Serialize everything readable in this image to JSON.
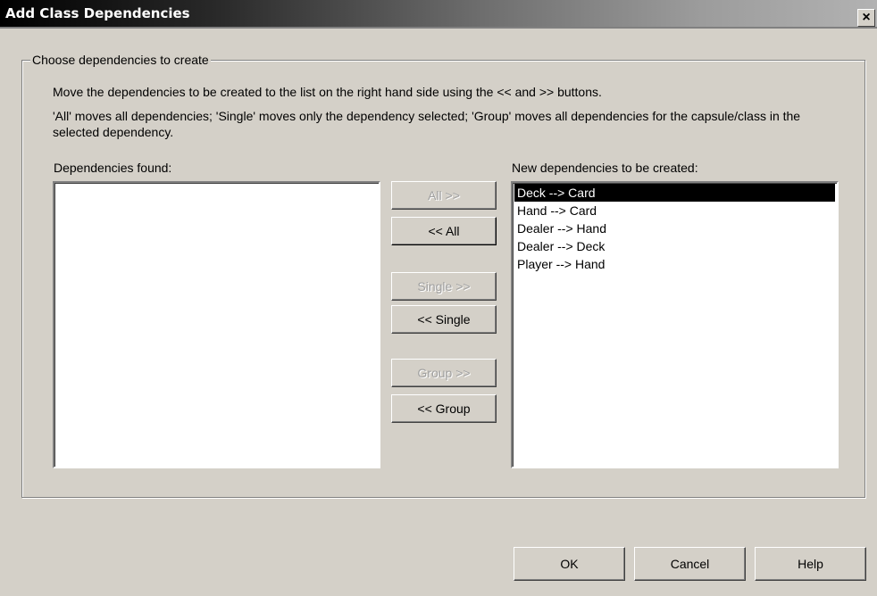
{
  "window": {
    "title": "Add Class Dependencies",
    "close_glyph": "×"
  },
  "group": {
    "legend": "Choose dependencies to create",
    "instruction1": "Move the dependencies to be created to the list on the right hand side using the << and >> buttons.",
    "instruction2": "'All' moves all dependencies; 'Single' moves only the dependency selected; 'Group' moves all dependencies for the capsule/class in the selected dependency."
  },
  "lists": {
    "found_label": "Dependencies found:",
    "new_label": "New dependencies to be created:",
    "found_items": [],
    "new_items": [
      {
        "text": "Deck --> Card",
        "selected": true
      },
      {
        "text": "Hand --> Card",
        "selected": false
      },
      {
        "text": "Dealer --> Hand",
        "selected": false
      },
      {
        "text": "Dealer --> Deck",
        "selected": false
      },
      {
        "text": "Player --> Hand",
        "selected": false
      }
    ]
  },
  "move_buttons": {
    "all_right": "All >>",
    "all_left": "<< All",
    "single_right": "Single >>",
    "single_left": "<< Single",
    "group_right": "Group >>",
    "group_left": "<< Group"
  },
  "footer": {
    "ok": "OK",
    "cancel": "Cancel",
    "help": "Help"
  }
}
